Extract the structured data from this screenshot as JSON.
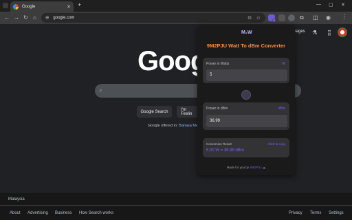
{
  "browser": {
    "tab_title": "Google",
    "tab_close": "✕",
    "new_tab": "+",
    "url": "google.com",
    "window_controls": [
      "—",
      "▢",
      "✕"
    ],
    "ext_badge": "2",
    "nav": {
      "back": "←",
      "forward": "→",
      "reload": "↻",
      "home": "⌂"
    },
    "menu": "⋮"
  },
  "google": {
    "logo": "Goog",
    "images_link": "Images",
    "labs_icon": "⚗",
    "apps_icon": "⋮⋮⋮",
    "search_button": "Google Search",
    "lucky_button": "I'm Feelin",
    "offered_in": "Google offered in:",
    "offered_lang": "Bahasa Me",
    "country": "Malaysia",
    "footer_left": [
      "About",
      "Advertising",
      "Business",
      "How Search works"
    ],
    "footer_right": [
      "Privacy",
      "Terms",
      "Settings"
    ]
  },
  "extension": {
    "logo_text": "M₂W",
    "title": "9M2PJU Watt To dBm Converter",
    "input_label": "Power in Watts",
    "input_unit": "W",
    "input_value": "5",
    "output_label": "Power in dBm",
    "output_unit": "dBm",
    "output_value": "36.99",
    "result_label": "Conversion Result",
    "result_copy": "Click to copy",
    "result_value": "5.00 W = 36.99 dBm",
    "made_by": "Made for you by",
    "made_by_brand": "9M2PJU",
    "made_by_icon": "☁"
  },
  "colors": {
    "accent": "#7b5cff",
    "title_orange": "#ff8a3d",
    "page_bg": "#202124"
  }
}
